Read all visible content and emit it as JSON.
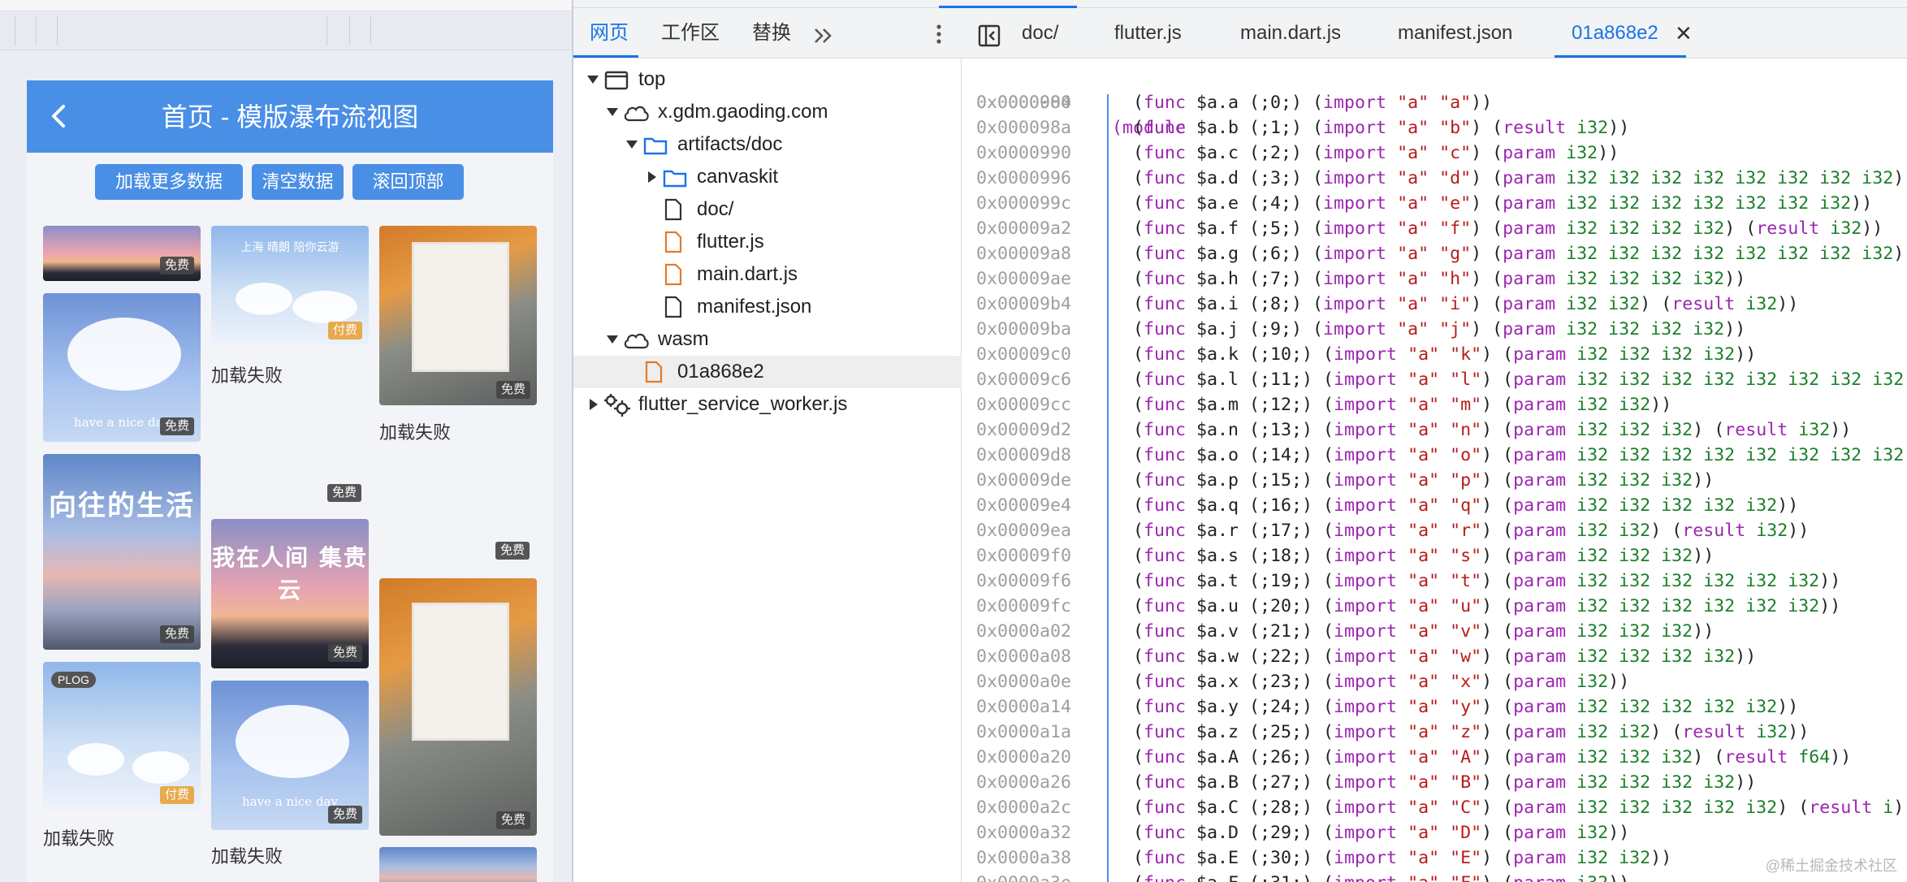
{
  "preview": {
    "app_title": "首页 - 模版瀑布流视图",
    "buttons": [
      "加载更多数据",
      "清空数据",
      "滚回顶部"
    ],
    "badge_free": "免费",
    "badge_paid": "付费",
    "load_failed": "加载失败",
    "plog_tag": "PLOG",
    "card_text": {
      "cloud_caption": "have a nice day",
      "life_title": "向往的生活",
      "sunset_title": "我在人间 集贵云",
      "cloud_script": "上海 晴朗 陪你云游"
    }
  },
  "devtools": {
    "sidebar_tabs": [
      "网页",
      "工作区",
      "替换"
    ],
    "tree": {
      "top": "top",
      "domain": "x.gdm.gaoding.com",
      "folder_artifacts": "artifacts/doc",
      "folder_canvaskit": "canvaskit",
      "file_doc": "doc/",
      "file_flutter": "flutter.js",
      "file_main": "main.dart.js",
      "file_manifest": "manifest.json",
      "wasm": "wasm",
      "file_wasm": "01a868e2",
      "worker": "flutter_service_worker.js"
    },
    "editor_tabs": [
      "doc/",
      "flutter.js",
      "main.dart.js",
      "manifest.json",
      "01a868e2"
    ],
    "active_editor_tab": "01a868e2",
    "code_header": {
      "addr": "0x0000000",
      "text": "(module"
    },
    "code_lines": [
      {
        "addr": "0x0000984",
        "name": "a",
        "idx": "0",
        "imp": "a",
        "p": "",
        "r": ""
      },
      {
        "addr": "0x000098a",
        "name": "b",
        "idx": "1",
        "imp": "b",
        "p": "",
        "r": "i32"
      },
      {
        "addr": "0x0000990",
        "name": "c",
        "idx": "2",
        "imp": "c",
        "p": "i32",
        "r": ""
      },
      {
        "addr": "0x0000996",
        "name": "d",
        "idx": "3",
        "imp": "d",
        "p": "i32 i32 i32 i32 i32 i32 i32 i32",
        "r": ""
      },
      {
        "addr": "0x000099c",
        "name": "e",
        "idx": "4",
        "imp": "e",
        "p": "i32 i32 i32 i32 i32 i32 i32",
        "r": ""
      },
      {
        "addr": "0x00009a2",
        "name": "f",
        "idx": "5",
        "imp": "f",
        "p": "i32 i32 i32 i32",
        "r": "i32"
      },
      {
        "addr": "0x00009a8",
        "name": "g",
        "idx": "6",
        "imp": "g",
        "p": "i32 i32 i32 i32 i32 i32 i32 i32",
        "r": ""
      },
      {
        "addr": "0x00009ae",
        "name": "h",
        "idx": "7",
        "imp": "h",
        "p": "i32 i32 i32 i32",
        "r": ""
      },
      {
        "addr": "0x00009b4",
        "name": "i",
        "idx": "8",
        "imp": "i",
        "p": "i32 i32",
        "r": "i32"
      },
      {
        "addr": "0x00009ba",
        "name": "j",
        "idx": "9",
        "imp": "j",
        "p": "i32 i32 i32 i32",
        "r": ""
      },
      {
        "addr": "0x00009c0",
        "name": "k",
        "idx": "10",
        "imp": "k",
        "p": "i32 i32 i32 i32",
        "r": ""
      },
      {
        "addr": "0x00009c6",
        "name": "l",
        "idx": "11",
        "imp": "l",
        "p": "i32 i32 i32 i32 i32 i32 i32 i32",
        "r": ""
      },
      {
        "addr": "0x00009cc",
        "name": "m",
        "idx": "12",
        "imp": "m",
        "p": "i32 i32",
        "r": ""
      },
      {
        "addr": "0x00009d2",
        "name": "n",
        "idx": "13",
        "imp": "n",
        "p": "i32 i32 i32",
        "r": "i32"
      },
      {
        "addr": "0x00009d8",
        "name": "o",
        "idx": "14",
        "imp": "o",
        "p": "i32 i32 i32 i32 i32 i32 i32 i32",
        "r": ""
      },
      {
        "addr": "0x00009de",
        "name": "p",
        "idx": "15",
        "imp": "p",
        "p": "i32 i32 i32",
        "r": ""
      },
      {
        "addr": "0x00009e4",
        "name": "q",
        "idx": "16",
        "imp": "q",
        "p": "i32 i32 i32 i32 i32",
        "r": ""
      },
      {
        "addr": "0x00009ea",
        "name": "r",
        "idx": "17",
        "imp": "r",
        "p": "i32 i32",
        "r": "i32"
      },
      {
        "addr": "0x00009f0",
        "name": "s",
        "idx": "18",
        "imp": "s",
        "p": "i32 i32 i32",
        "r": ""
      },
      {
        "addr": "0x00009f6",
        "name": "t",
        "idx": "19",
        "imp": "t",
        "p": "i32 i32 i32 i32 i32 i32",
        "r": ""
      },
      {
        "addr": "0x00009fc",
        "name": "u",
        "idx": "20",
        "imp": "u",
        "p": "i32 i32 i32 i32 i32 i32",
        "r": ""
      },
      {
        "addr": "0x0000a02",
        "name": "v",
        "idx": "21",
        "imp": "v",
        "p": "i32 i32 i32",
        "r": ""
      },
      {
        "addr": "0x0000a08",
        "name": "w",
        "idx": "22",
        "imp": "w",
        "p": "i32 i32 i32 i32",
        "r": ""
      },
      {
        "addr": "0x0000a0e",
        "name": "x",
        "idx": "23",
        "imp": "x",
        "p": "i32",
        "r": ""
      },
      {
        "addr": "0x0000a14",
        "name": "y",
        "idx": "24",
        "imp": "y",
        "p": "i32 i32 i32 i32 i32",
        "r": ""
      },
      {
        "addr": "0x0000a1a",
        "name": "z",
        "idx": "25",
        "imp": "z",
        "p": "i32 i32",
        "r": "i32"
      },
      {
        "addr": "0x0000a20",
        "name": "A",
        "idx": "26",
        "imp": "A",
        "p": "i32 i32 i32",
        "r": "f64"
      },
      {
        "addr": "0x0000a26",
        "name": "B",
        "idx": "27",
        "imp": "B",
        "p": "i32 i32 i32 i32",
        "r": ""
      },
      {
        "addr": "0x0000a2c",
        "name": "C",
        "idx": "28",
        "imp": "C",
        "p": "i32 i32 i32 i32 i32",
        "r": "i"
      },
      {
        "addr": "0x0000a32",
        "name": "D",
        "idx": "29",
        "imp": "D",
        "p": "i32",
        "r": ""
      },
      {
        "addr": "0x0000a38",
        "name": "E",
        "idx": "30",
        "imp": "E",
        "p": "i32 i32",
        "r": ""
      },
      {
        "addr": "0x0000a3e",
        "name": "F",
        "idx": "31",
        "imp": "F",
        "p": "i32",
        "r": ""
      }
    ],
    "watermark": "@稀土掘金技术社区"
  },
  "colors": {
    "accent": "#1a73e8",
    "app_blue": "#4a8fe6",
    "keyword": "#9c27b0",
    "string": "#b71c1c",
    "type": "#1b7f2a",
    "address": "#9e9e9e"
  }
}
